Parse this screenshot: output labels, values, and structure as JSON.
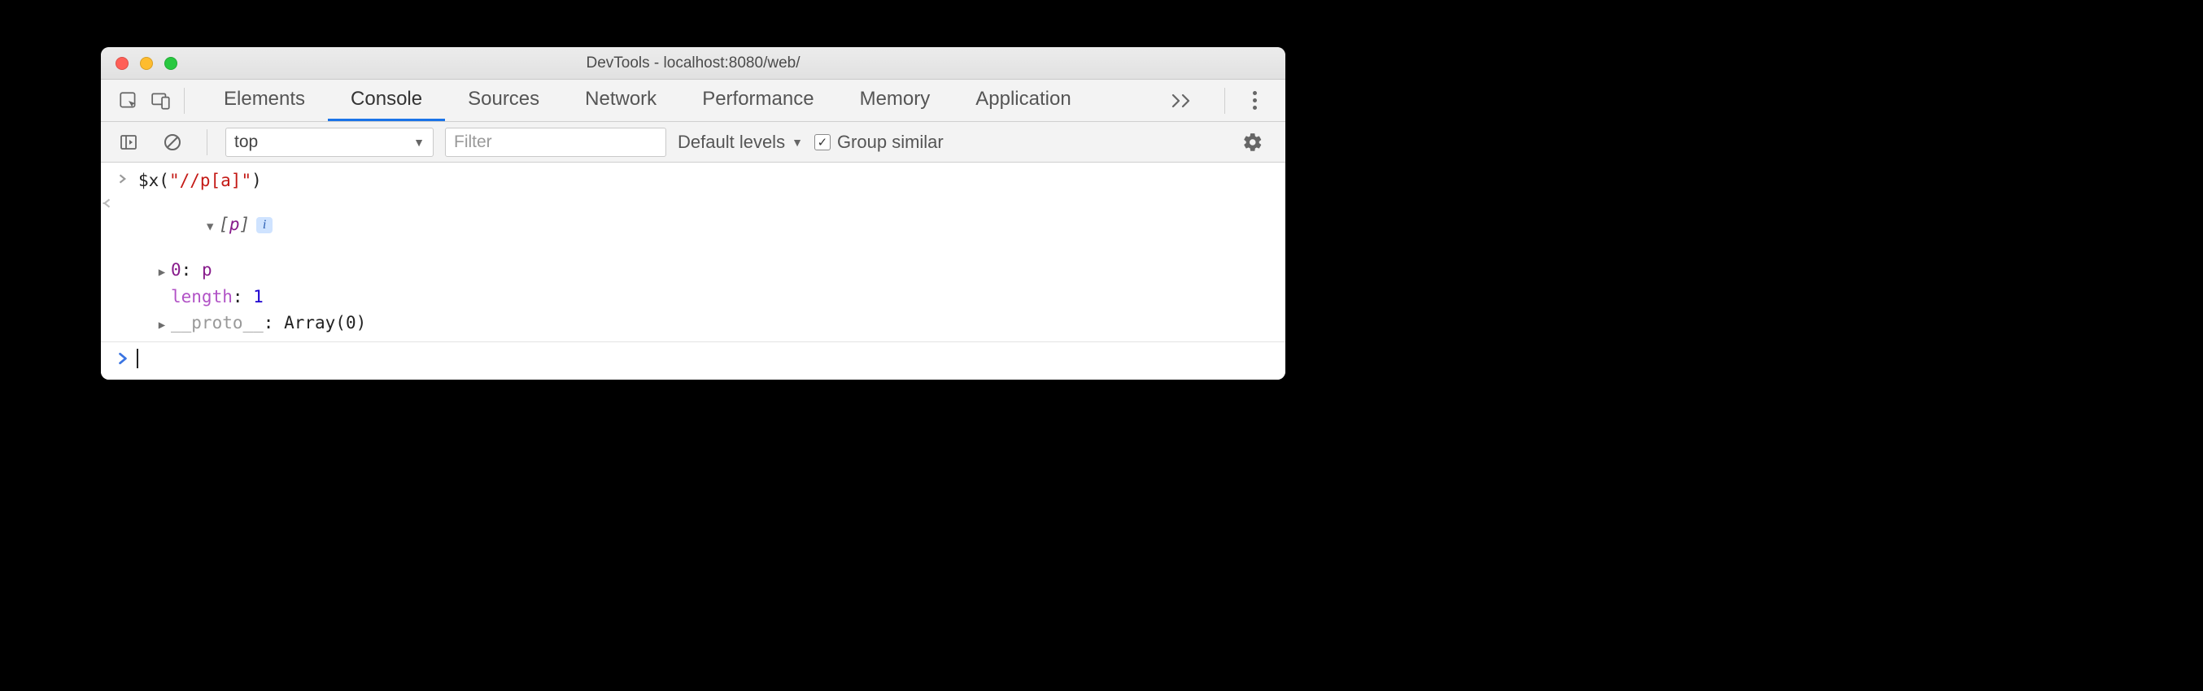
{
  "window": {
    "title": "DevTools - localhost:8080/web/"
  },
  "tabs": {
    "items": [
      {
        "label": "Elements"
      },
      {
        "label": "Console"
      },
      {
        "label": "Sources"
      },
      {
        "label": "Network"
      },
      {
        "label": "Performance"
      },
      {
        "label": "Memory"
      },
      {
        "label": "Application"
      }
    ],
    "activeIndex": 1
  },
  "filterbar": {
    "context_label": "top",
    "filter_placeholder": "Filter",
    "levels_label": "Default levels",
    "group_similar_label": "Group similar",
    "group_similar_checked": true
  },
  "console": {
    "input_expr": {
      "fn": "$x",
      "arg": "\"//p[a]\""
    },
    "output": {
      "summary_open": "[",
      "summary_items": "p",
      "summary_close": "]",
      "entries": [
        {
          "kind": "index",
          "key": "0",
          "value": "p"
        },
        {
          "kind": "prop",
          "key": "length",
          "value": "1"
        },
        {
          "kind": "proto",
          "key": "__proto__",
          "value": "Array(0)"
        }
      ]
    }
  }
}
